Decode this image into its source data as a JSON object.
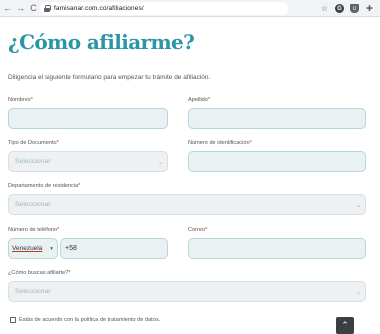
{
  "browser": {
    "back_glyph": "←",
    "forward_glyph": "→",
    "reload_glyph": "C",
    "home_glyph": "⌂",
    "url": "famisanar.com.co/afiliaciones/",
    "icons": [
      "star-icon",
      "account-icon",
      "shield-extension-icon",
      "puzzle-extension-icon"
    ],
    "star_glyph": "☆",
    "account_glyph": "G",
    "shield_glyph": "U",
    "puzzle_glyph": "✚"
  },
  "page": {
    "title": "¿Cómo afiliarme?",
    "intro": "Diligencia el siguiente formulario para empezar tu trámite de afiliación."
  },
  "form": {
    "nombres_label": "Nombres",
    "apellido_label": "Apellido",
    "tipo_documento_label": "Tipo de Documento",
    "tipo_documento_placeholder": "Seleccionar",
    "numero_identificacion_label": "Número de identificación",
    "departamento_label": "Departamento de residencia",
    "departamento_placeholder": "Seleccionar",
    "telefono_label": "Número de teléfono",
    "pais_value": "Venezuela",
    "prefijo_value": "+58",
    "correo_label": "Correo",
    "afiliarte_label": "¿Cómo buscas afiliarte?",
    "afiliarte_placeholder": "Seleccionar",
    "required_mark": "*",
    "terminos_label": "Estás de acuerdo con la política de tratamiento de datos.",
    "chevron_glyph": "⌄",
    "country_chevron_glyph": "▾"
  },
  "scroll_top_glyph": "⌃",
  "colors": {
    "title": "#2a95a4",
    "field_border": "#b5d7da",
    "field_bg": "#eaf1f3",
    "required": "#d93025",
    "scroll_button": "#3a3f44"
  }
}
